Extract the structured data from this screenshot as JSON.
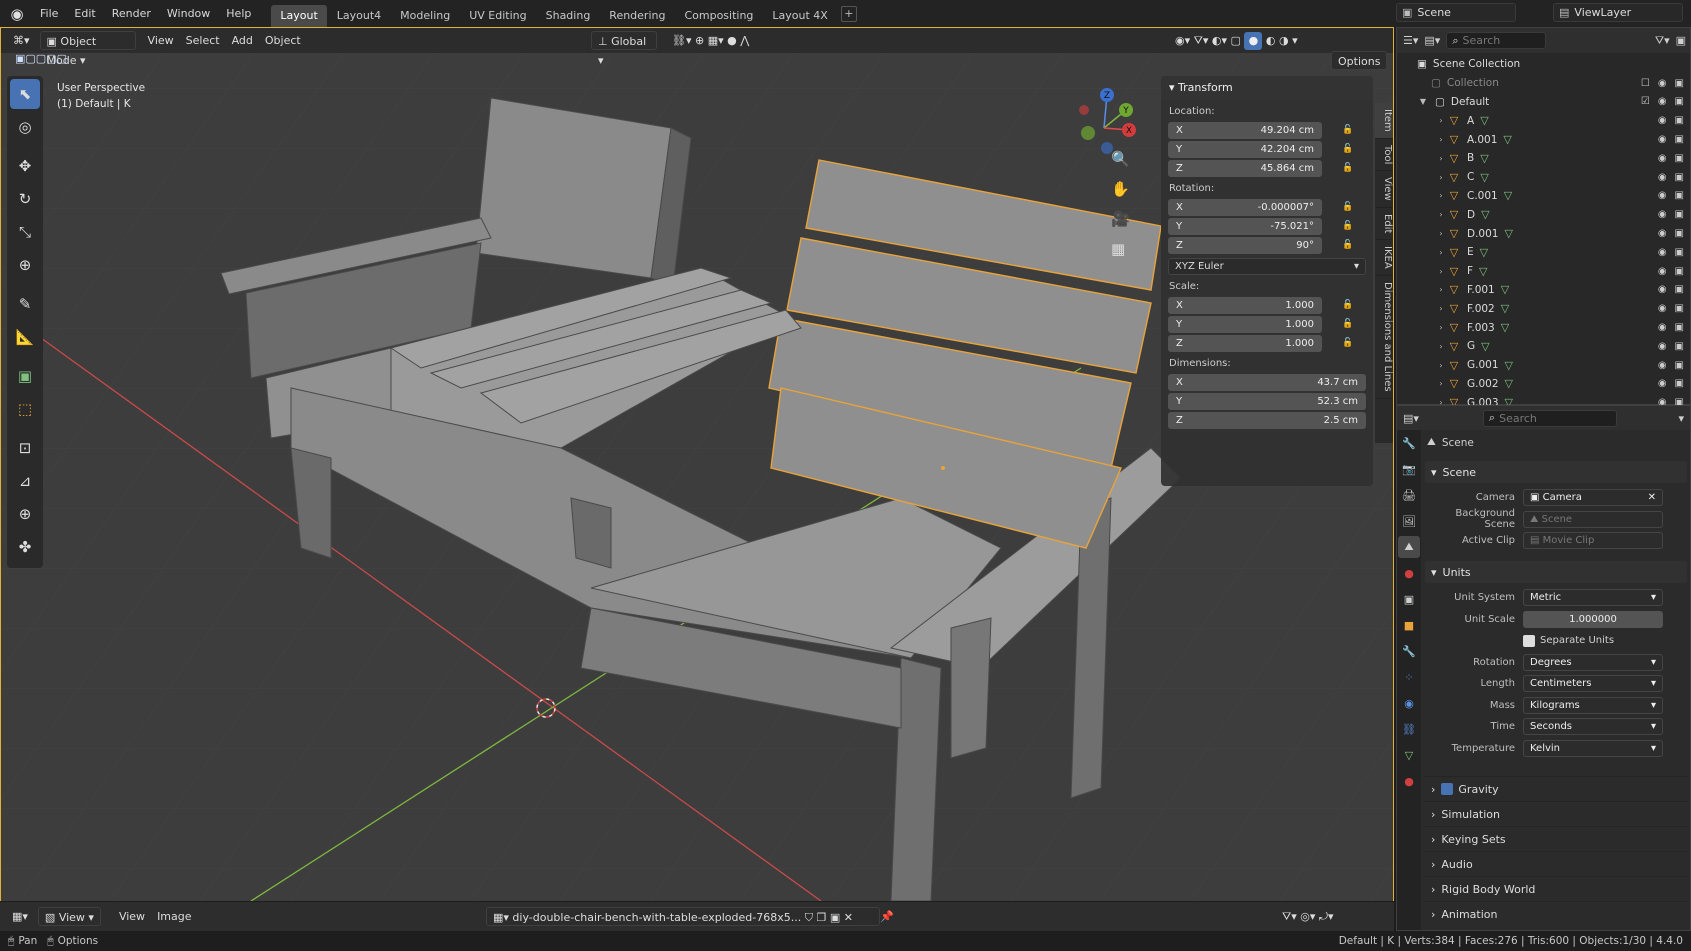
{
  "app": {
    "menu": [
      "File",
      "Edit",
      "Render",
      "Window",
      "Help"
    ],
    "workspaces": [
      "Layout",
      "Layout4",
      "Modeling",
      "UV Editing",
      "Shading",
      "Rendering",
      "Compositing",
      "Layout 4X"
    ],
    "active_workspace": "Layout",
    "scene": "Scene",
    "view_layer": "ViewLayer"
  },
  "viewport": {
    "mode": "Object Mode",
    "menus": [
      "View",
      "Select",
      "Add",
      "Object"
    ],
    "orientation": "Global",
    "options": "Options",
    "overlay_text_1": "User Perspective",
    "overlay_text_2": "(1) Default | K"
  },
  "npanel": {
    "title": "Transform",
    "location_label": "Location:",
    "rotation_label": "Rotation:",
    "scale_label": "Scale:",
    "dimensions_label": "Dimensions:",
    "location": [
      {
        "axis": "X",
        "value": "49.204 cm"
      },
      {
        "axis": "Y",
        "value": "42.204 cm"
      },
      {
        "axis": "Z",
        "value": "45.864 cm"
      }
    ],
    "rotation": [
      {
        "axis": "X",
        "value": "-0.000007°"
      },
      {
        "axis": "Y",
        "value": "-75.021°"
      },
      {
        "axis": "Z",
        "value": "90°"
      }
    ],
    "rotation_mode": "XYZ Euler",
    "scale": [
      {
        "axis": "X",
        "value": "1.000"
      },
      {
        "axis": "Y",
        "value": "1.000"
      },
      {
        "axis": "Z",
        "value": "1.000"
      }
    ],
    "dimensions": [
      {
        "axis": "X",
        "value": "43.7 cm"
      },
      {
        "axis": "Y",
        "value": "52.3 cm"
      },
      {
        "axis": "Z",
        "value": "2.5 cm"
      }
    ],
    "tabs": [
      "Item",
      "Tool",
      "View",
      "Edit",
      "IKEA",
      "Dimensions and Lines"
    ]
  },
  "footer": {
    "menus": [
      "View",
      "View",
      "Image"
    ],
    "image_name": "diy-double-chair-bench-with-table-exploded-768x5..."
  },
  "status": {
    "left_1": "Pan",
    "left_2": "Options",
    "right": "Default | K | Verts:384 | Faces:276 | Tris:600 | Objects:1/30 | 4.4.0"
  },
  "outliner": {
    "search_placeholder": "Search",
    "scene_collection": "Scene Collection",
    "collection": "Collection",
    "default": "Default",
    "items": [
      "A",
      "A.001",
      "B",
      "C",
      "C.001",
      "D",
      "D.001",
      "E",
      "F",
      "F.001",
      "F.002",
      "F.003",
      "G",
      "G.001",
      "G.002",
      "G.003"
    ]
  },
  "properties": {
    "search_placeholder": "Search",
    "breadcrumb": "Scene",
    "scene_section": "Scene",
    "camera_label": "Camera",
    "camera_value": "Camera",
    "bg_label": "Background Scene",
    "bg_value": "Scene",
    "clip_label": "Active Clip",
    "clip_value": "Movie Clip",
    "units_section": "Units",
    "unit_system_label": "Unit System",
    "unit_system": "Metric",
    "unit_scale_label": "Unit Scale",
    "unit_scale": "1.000000",
    "separate_units": "Separate Units",
    "rotation_label": "Rotation",
    "rotation": "Degrees",
    "length_label": "Length",
    "length": "Centimeters",
    "mass_label": "Mass",
    "mass": "Kilograms",
    "time_label": "Time",
    "time": "Seconds",
    "temp_label": "Temperature",
    "temp": "Kelvin",
    "gravity": "Gravity",
    "simulation": "Simulation",
    "keying_sets": "Keying Sets",
    "audio": "Audio",
    "rigid_body": "Rigid Body World",
    "animation": "Animation"
  },
  "colors": {
    "accent": "#4772b3",
    "selection": "#e8a33b",
    "x_axis": "#e44c4c",
    "y_axis": "#8bc34a"
  }
}
